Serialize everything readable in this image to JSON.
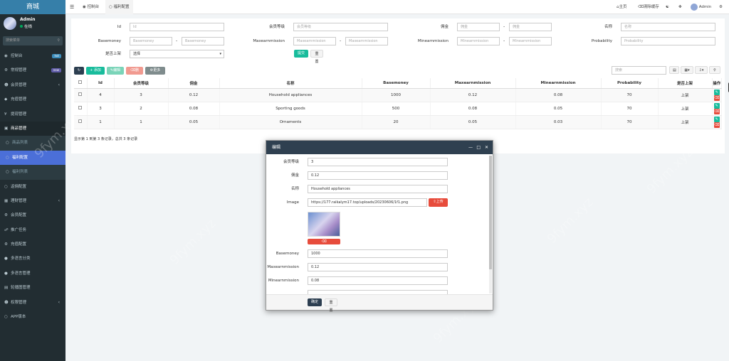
{
  "sidebar": {
    "title": "商城",
    "user_name": "Admin",
    "user_status": "在线",
    "search_placeholder": "搜索菜单",
    "items": [
      {
        "label": "控制台",
        "badge": "hot",
        "badge_color": "#3c8dbc"
      },
      {
        "label": "常规管理",
        "badge": "new",
        "badge_color": "#605ca8"
      },
      {
        "label": "会员管理"
      },
      {
        "label": "充值管理"
      },
      {
        "label": "提现管理"
      },
      {
        "label": "商品管理"
      },
      {
        "label": "商品列表"
      },
      {
        "label": "福利配置"
      },
      {
        "label": "福利列表"
      },
      {
        "label": "返佣配置"
      },
      {
        "label": "理财管理"
      },
      {
        "label": "会员配置"
      },
      {
        "label": "推广任务"
      },
      {
        "label": "充值配置"
      },
      {
        "label": "多语言分类"
      },
      {
        "label": "多语言管理"
      },
      {
        "label": "轮播图管理"
      },
      {
        "label": "权限管理"
      },
      {
        "label": "APP版本"
      }
    ]
  },
  "topbar": {
    "tab1": "控制台",
    "tab2": "福利配置",
    "home": "主页",
    "clear_cache": "清除缓存",
    "admin": "Admin"
  },
  "filters": {
    "id_label": "Id",
    "id_ph": "Id",
    "level_label": "会员等级",
    "level_ph": "会员等级",
    "commission_label": "佣金",
    "commission_min_ph": "佣金",
    "commission_max_ph": "佣金",
    "name_label": "名称",
    "name_ph": "名称",
    "basemoney_label": "Basemoney",
    "basemoney_min_ph": "Basemoney",
    "basemoney_max_ph": "Basemoney",
    "maxearn_label": "Maxearnmission",
    "maxearn_min_ph": "Maxearnmission",
    "maxearn_max_ph": "Maxearnmission",
    "minearn_label": "Minearnmission",
    "minearn_min_ph": "Minearnmission",
    "minearn_max_ph": "Minearnmission",
    "prob_label": "Probability",
    "prob_ph": "Probability",
    "onsale_label": "是否上架",
    "onsale_value": "选择",
    "submit": "提交",
    "reset": "重置"
  },
  "toolbar": {
    "add": "添加",
    "edit": "编辑",
    "delete": "删除",
    "more": "更多",
    "search_ph": "搜索"
  },
  "table": {
    "headers": [
      "Id",
      "会员等级",
      "佣金",
      "名称",
      "Basemoney",
      "Maxearnmission",
      "Minearnmission",
      "Probability",
      "是否上架",
      "操作"
    ],
    "rows": [
      [
        "4",
        "3",
        "0.12",
        "Household appliances",
        "1000",
        "0.12",
        "0.08",
        "70",
        "上架"
      ],
      [
        "3",
        "2",
        "0.08",
        "Sporting goods",
        "500",
        "0.08",
        "0.05",
        "70",
        "上架"
      ],
      [
        "1",
        "1",
        "0.05",
        "Ornaments",
        "20",
        "0.05",
        "0.03",
        "70",
        "上架"
      ]
    ],
    "tooltip": "编辑",
    "info": "显示第 1 到第 3 条记录，总共 3 条记录"
  },
  "modal": {
    "title": "编辑",
    "level_label": "会员等级",
    "level_value": "3",
    "commission_label": "佣金",
    "commission_value": "0.12",
    "name_label": "名称",
    "name_value": "Household appliances",
    "image_label": "Image",
    "image_value": "https://177.raikalym17.top/uploads/20230606/1f1.png",
    "upload": "上传",
    "basemoney_label": "Basemoney",
    "basemoney_value": "1000",
    "maxearn_label": "Maxearnmission",
    "maxearn_value": "0.12",
    "minearn_label": "Minearnmission",
    "minearn_value": "0.08",
    "confirm": "确定",
    "reset": "重置"
  },
  "watermark": "9fym.xyz",
  "colors": {
    "accent": "#18bc9c",
    "primary": "#2c3e50",
    "danger": "#e74c3c",
    "info": "#3498db"
  }
}
